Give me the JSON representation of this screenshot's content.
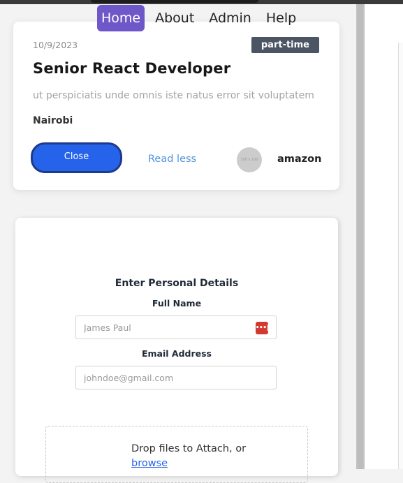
{
  "nav": {
    "items": [
      {
        "label": "Home",
        "active": true
      },
      {
        "label": "About",
        "active": false
      },
      {
        "label": "Admin",
        "active": false
      },
      {
        "label": "Help",
        "active": false
      }
    ]
  },
  "job": {
    "date": "10/9/2023",
    "type": "part-time",
    "title": "Senior React Developer",
    "description": "ut perspiciatis unde omnis iste natus error sit voluptatem",
    "location": "Nairobi",
    "close_label": "Close",
    "read_less_label": "Read less",
    "logo_text": "100 x 100",
    "company": "amazon"
  },
  "form": {
    "title": "Enter Personal Details",
    "full_name": {
      "label": "Full Name",
      "placeholder": "James Paul",
      "autofill_icon_text": "•••|"
    },
    "email": {
      "label": "Email Address",
      "placeholder": "johndoe@gmail.com"
    },
    "dropzone": {
      "text": "Drop files to Attach, or",
      "browse_label": "browse"
    }
  },
  "colors": {
    "nav_active": "#6e57c8",
    "close_button": "#2563eb",
    "link": "#4f93dd",
    "badge": "#4b5563"
  }
}
